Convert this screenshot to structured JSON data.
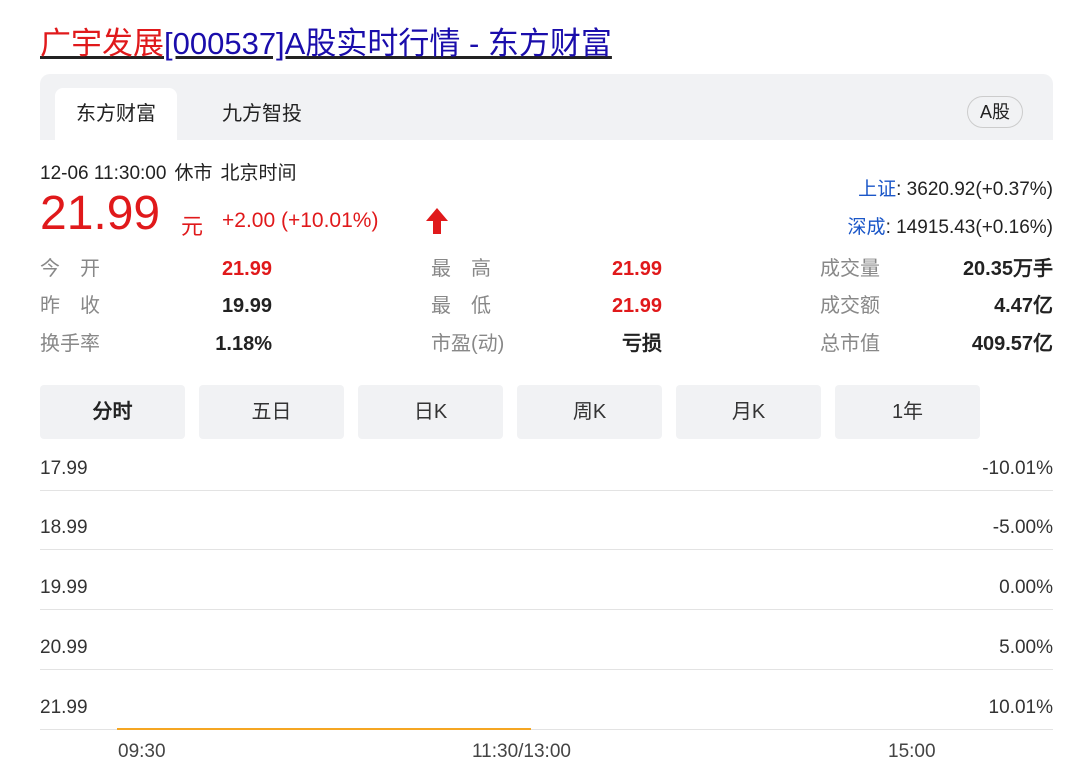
{
  "title": {
    "highlight": "广宇发展",
    "rest": "[000537]A股实时行情 - 东方财富"
  },
  "tabs": [
    {
      "label": "东方财富",
      "active": true
    },
    {
      "label": "九方智投",
      "active": false
    }
  ],
  "market_badge": "A股",
  "status": {
    "datetime": "12-06 11:30:00",
    "state": "休市",
    "timezone": "北京时间"
  },
  "price": {
    "current": "21.99",
    "unit": "元",
    "change": "+2.00 (+10.01%)",
    "direction": "up-arrow-icon"
  },
  "indices": [
    {
      "name": "上证",
      "value": ": 3620.92(+0.37%)"
    },
    {
      "name": "深成",
      "value": ": 14915.43(+0.16%)"
    }
  ],
  "stats": {
    "open": {
      "label": "今　开",
      "value": "21.99"
    },
    "prev_close": {
      "label": "昨　收",
      "value": "19.99"
    },
    "turnover_rate": {
      "label": "换手率",
      "value": "1.18%"
    },
    "high": {
      "label": "最　高",
      "value": "21.99"
    },
    "low": {
      "label": "最　低",
      "value": "21.99"
    },
    "pe": {
      "label": "市盈(动)",
      "value": "亏损"
    },
    "volume": {
      "label": "成交量",
      "value": "20.35万手"
    },
    "amount": {
      "label": "成交额",
      "value": "4.47亿"
    },
    "market_cap": {
      "label": "总市值",
      "value": "409.57亿"
    }
  },
  "period_tabs": [
    "分时",
    "五日",
    "日K",
    "周K",
    "月K",
    "1年"
  ],
  "active_period": "分时",
  "chart": {
    "price_labels": [
      "17.99",
      "18.99",
      "19.99",
      "20.99",
      "21.99"
    ],
    "pct_labels": [
      "-10.01%",
      "-5.00%",
      "0.00%",
      "5.00%",
      "10.01%"
    ],
    "time_labels": [
      "09:30",
      "11:30/13:00",
      "15:00"
    ],
    "line_color": "#f5a623"
  },
  "colors": {
    "up": "#e0191b",
    "link": "#1a0dab",
    "index_name": "#1a56c8"
  }
}
